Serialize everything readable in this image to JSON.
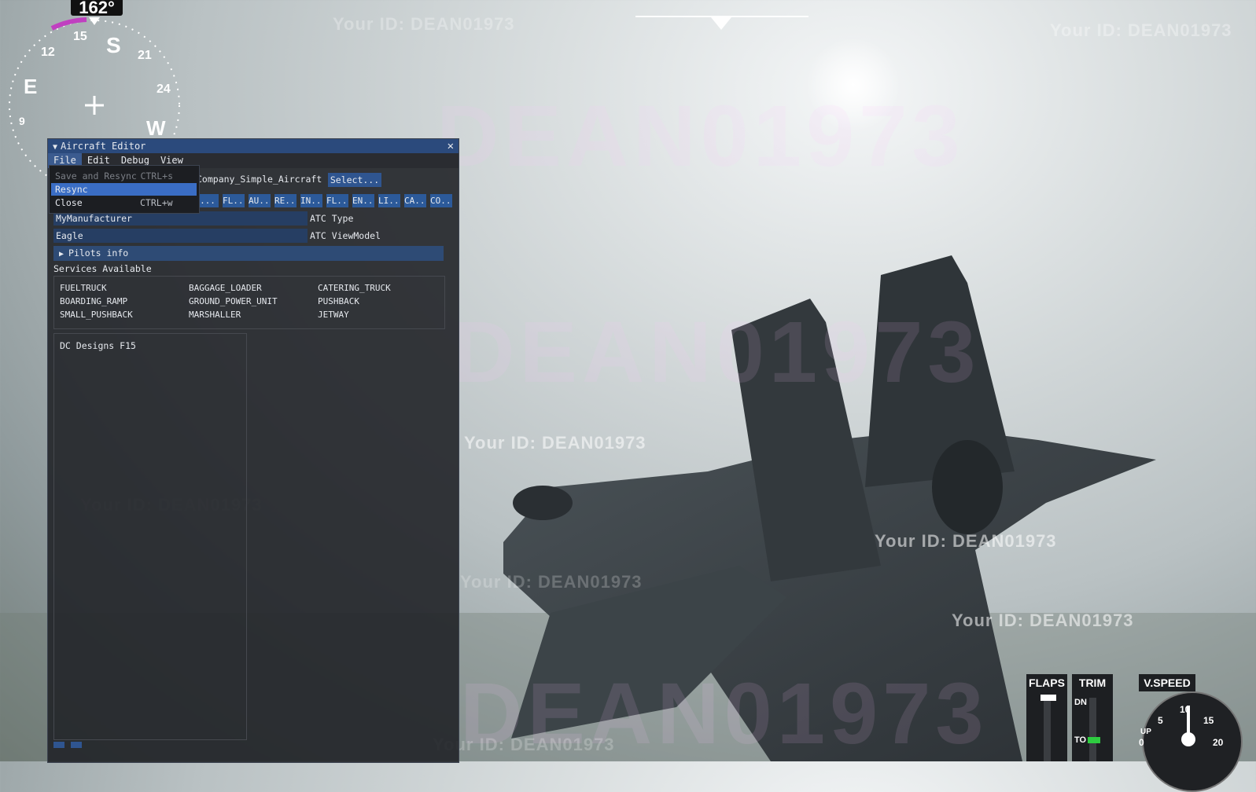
{
  "hud": {
    "heading": "162°",
    "compass_labels": [
      "15",
      "S",
      "21",
      "24",
      "W",
      "12",
      "E",
      "9"
    ]
  },
  "watermarks": {
    "small": "Your ID: DEAN01973",
    "big": "DEAN01973"
  },
  "editor": {
    "title": "Aircraft Editor",
    "menu": [
      "File",
      "Edit",
      "Debug",
      "View"
    ],
    "path": "Company_Simple_Aircraft",
    "select_label": "Select...",
    "tabs": [
      "...",
      "FL...",
      "AU...",
      "RE...",
      "IN...",
      "FL...",
      "EN...",
      "LI...",
      "CA...",
      "CO..."
    ],
    "fields": [
      {
        "value": "MyManufacturer",
        "label": "ATC Type"
      },
      {
        "value": "Eagle",
        "label": "ATC ViewModel"
      }
    ],
    "pilots_info": "Pilots info",
    "services_label": "Services Available",
    "services": [
      [
        "FUELTRUCK",
        "BAGGAGE_LOADER",
        "CATERING_TRUCK"
      ],
      [
        "BOARDING_RAMP",
        "GROUND_POWER_UNIT",
        "PUSHBACK"
      ],
      [
        "SMALL_PUSHBACK",
        "MARSHALLER",
        "JETWAY"
      ]
    ],
    "list_items": [
      "DC Designs F15"
    ]
  },
  "file_menu": {
    "items": [
      {
        "label": "Save and Resync",
        "shortcut": "CTRL+s",
        "state": "disabled"
      },
      {
        "label": "Resync",
        "shortcut": "",
        "state": "highlighted"
      },
      {
        "label": "Close",
        "shortcut": "CTRL+w",
        "state": "normal"
      }
    ]
  },
  "instruments": {
    "flaps": "FLAPS",
    "trim": "TRIM",
    "trim_dn": "DN",
    "trim_to": "TO",
    "vspeed": "V.SPEED",
    "vs_labels": [
      "5",
      "10",
      "15",
      "UP",
      "0",
      "20"
    ]
  },
  "colors": {
    "title_bar": "#2b4a7c",
    "highlight": "#3a6dc4",
    "tab": "#2c5a9a",
    "field": "#263e63"
  }
}
